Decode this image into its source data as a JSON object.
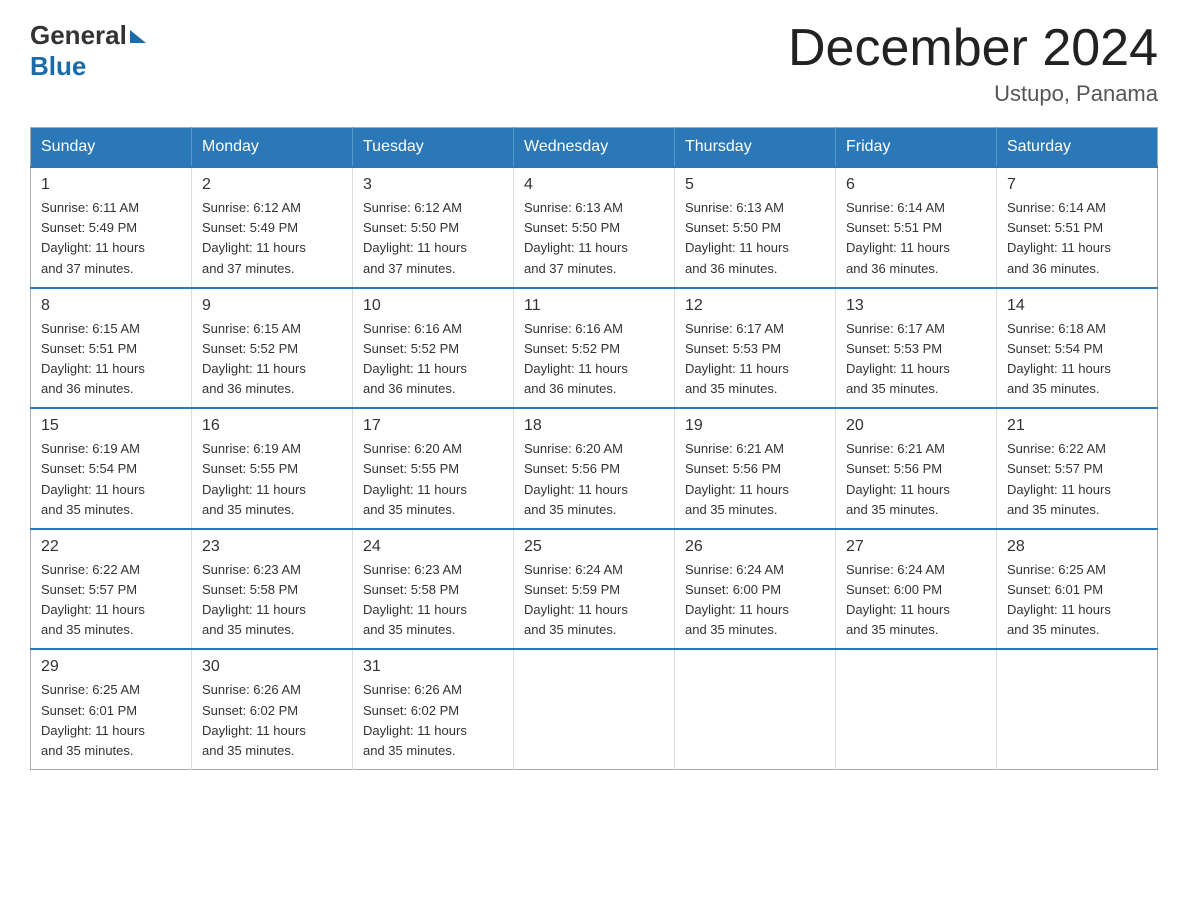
{
  "header": {
    "logo_general": "General",
    "logo_blue": "Blue",
    "title": "December 2024",
    "location": "Ustupo, Panama"
  },
  "calendar": {
    "days_of_week": [
      "Sunday",
      "Monday",
      "Tuesday",
      "Wednesday",
      "Thursday",
      "Friday",
      "Saturday"
    ],
    "weeks": [
      [
        {
          "day": "1",
          "sunrise": "6:11 AM",
          "sunset": "5:49 PM",
          "daylight": "11 hours and 37 minutes."
        },
        {
          "day": "2",
          "sunrise": "6:12 AM",
          "sunset": "5:49 PM",
          "daylight": "11 hours and 37 minutes."
        },
        {
          "day": "3",
          "sunrise": "6:12 AM",
          "sunset": "5:50 PM",
          "daylight": "11 hours and 37 minutes."
        },
        {
          "day": "4",
          "sunrise": "6:13 AM",
          "sunset": "5:50 PM",
          "daylight": "11 hours and 37 minutes."
        },
        {
          "day": "5",
          "sunrise": "6:13 AM",
          "sunset": "5:50 PM",
          "daylight": "11 hours and 36 minutes."
        },
        {
          "day": "6",
          "sunrise": "6:14 AM",
          "sunset": "5:51 PM",
          "daylight": "11 hours and 36 minutes."
        },
        {
          "day": "7",
          "sunrise": "6:14 AM",
          "sunset": "5:51 PM",
          "daylight": "11 hours and 36 minutes."
        }
      ],
      [
        {
          "day": "8",
          "sunrise": "6:15 AM",
          "sunset": "5:51 PM",
          "daylight": "11 hours and 36 minutes."
        },
        {
          "day": "9",
          "sunrise": "6:15 AM",
          "sunset": "5:52 PM",
          "daylight": "11 hours and 36 minutes."
        },
        {
          "day": "10",
          "sunrise": "6:16 AM",
          "sunset": "5:52 PM",
          "daylight": "11 hours and 36 minutes."
        },
        {
          "day": "11",
          "sunrise": "6:16 AM",
          "sunset": "5:52 PM",
          "daylight": "11 hours and 36 minutes."
        },
        {
          "day": "12",
          "sunrise": "6:17 AM",
          "sunset": "5:53 PM",
          "daylight": "11 hours and 35 minutes."
        },
        {
          "day": "13",
          "sunrise": "6:17 AM",
          "sunset": "5:53 PM",
          "daylight": "11 hours and 35 minutes."
        },
        {
          "day": "14",
          "sunrise": "6:18 AM",
          "sunset": "5:54 PM",
          "daylight": "11 hours and 35 minutes."
        }
      ],
      [
        {
          "day": "15",
          "sunrise": "6:19 AM",
          "sunset": "5:54 PM",
          "daylight": "11 hours and 35 minutes."
        },
        {
          "day": "16",
          "sunrise": "6:19 AM",
          "sunset": "5:55 PM",
          "daylight": "11 hours and 35 minutes."
        },
        {
          "day": "17",
          "sunrise": "6:20 AM",
          "sunset": "5:55 PM",
          "daylight": "11 hours and 35 minutes."
        },
        {
          "day": "18",
          "sunrise": "6:20 AM",
          "sunset": "5:56 PM",
          "daylight": "11 hours and 35 minutes."
        },
        {
          "day": "19",
          "sunrise": "6:21 AM",
          "sunset": "5:56 PM",
          "daylight": "11 hours and 35 minutes."
        },
        {
          "day": "20",
          "sunrise": "6:21 AM",
          "sunset": "5:56 PM",
          "daylight": "11 hours and 35 minutes."
        },
        {
          "day": "21",
          "sunrise": "6:22 AM",
          "sunset": "5:57 PM",
          "daylight": "11 hours and 35 minutes."
        }
      ],
      [
        {
          "day": "22",
          "sunrise": "6:22 AM",
          "sunset": "5:57 PM",
          "daylight": "11 hours and 35 minutes."
        },
        {
          "day": "23",
          "sunrise": "6:23 AM",
          "sunset": "5:58 PM",
          "daylight": "11 hours and 35 minutes."
        },
        {
          "day": "24",
          "sunrise": "6:23 AM",
          "sunset": "5:58 PM",
          "daylight": "11 hours and 35 minutes."
        },
        {
          "day": "25",
          "sunrise": "6:24 AM",
          "sunset": "5:59 PM",
          "daylight": "11 hours and 35 minutes."
        },
        {
          "day": "26",
          "sunrise": "6:24 AM",
          "sunset": "6:00 PM",
          "daylight": "11 hours and 35 minutes."
        },
        {
          "day": "27",
          "sunrise": "6:24 AM",
          "sunset": "6:00 PM",
          "daylight": "11 hours and 35 minutes."
        },
        {
          "day": "28",
          "sunrise": "6:25 AM",
          "sunset": "6:01 PM",
          "daylight": "11 hours and 35 minutes."
        }
      ],
      [
        {
          "day": "29",
          "sunrise": "6:25 AM",
          "sunset": "6:01 PM",
          "daylight": "11 hours and 35 minutes."
        },
        {
          "day": "30",
          "sunrise": "6:26 AM",
          "sunset": "6:02 PM",
          "daylight": "11 hours and 35 minutes."
        },
        {
          "day": "31",
          "sunrise": "6:26 AM",
          "sunset": "6:02 PM",
          "daylight": "11 hours and 35 minutes."
        },
        null,
        null,
        null,
        null
      ]
    ],
    "labels": {
      "sunrise": "Sunrise: ",
      "sunset": "Sunset: ",
      "daylight": "Daylight: "
    }
  }
}
